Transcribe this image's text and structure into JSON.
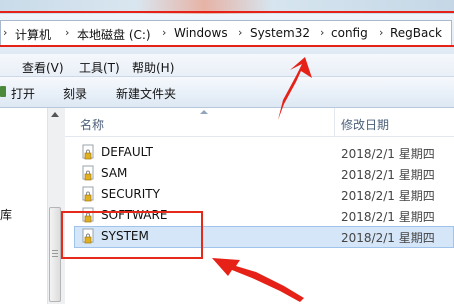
{
  "address_bar": {
    "crumbs": [
      "计算机",
      "本地磁盘 (C:)",
      "Windows",
      "System32",
      "config",
      "RegBack"
    ],
    "separator": "›"
  },
  "menu": {
    "items": [
      "查看(V)",
      "工具(T)",
      "帮助(H)"
    ]
  },
  "toolbar": {
    "items": [
      "打开",
      "刻录",
      "新建文件夹"
    ]
  },
  "nav_pane": {
    "partial_label": "库"
  },
  "columns": {
    "name": "名称",
    "date": "修改日期"
  },
  "files": [
    {
      "name": "DEFAULT",
      "date": "2018/2/1 星期四"
    },
    {
      "name": "SAM",
      "date": "2018/2/1 星期四"
    },
    {
      "name": "SECURITY",
      "date": "2018/2/1 星期四"
    },
    {
      "name": "SOFTWARE",
      "date": "2018/2/1 星期四"
    },
    {
      "name": "SYSTEM",
      "date": "2018/2/1 星期四"
    }
  ],
  "selected_file": "SYSTEM",
  "colors": {
    "annotation": "#e62117",
    "selection": "#d5e6f8"
  }
}
